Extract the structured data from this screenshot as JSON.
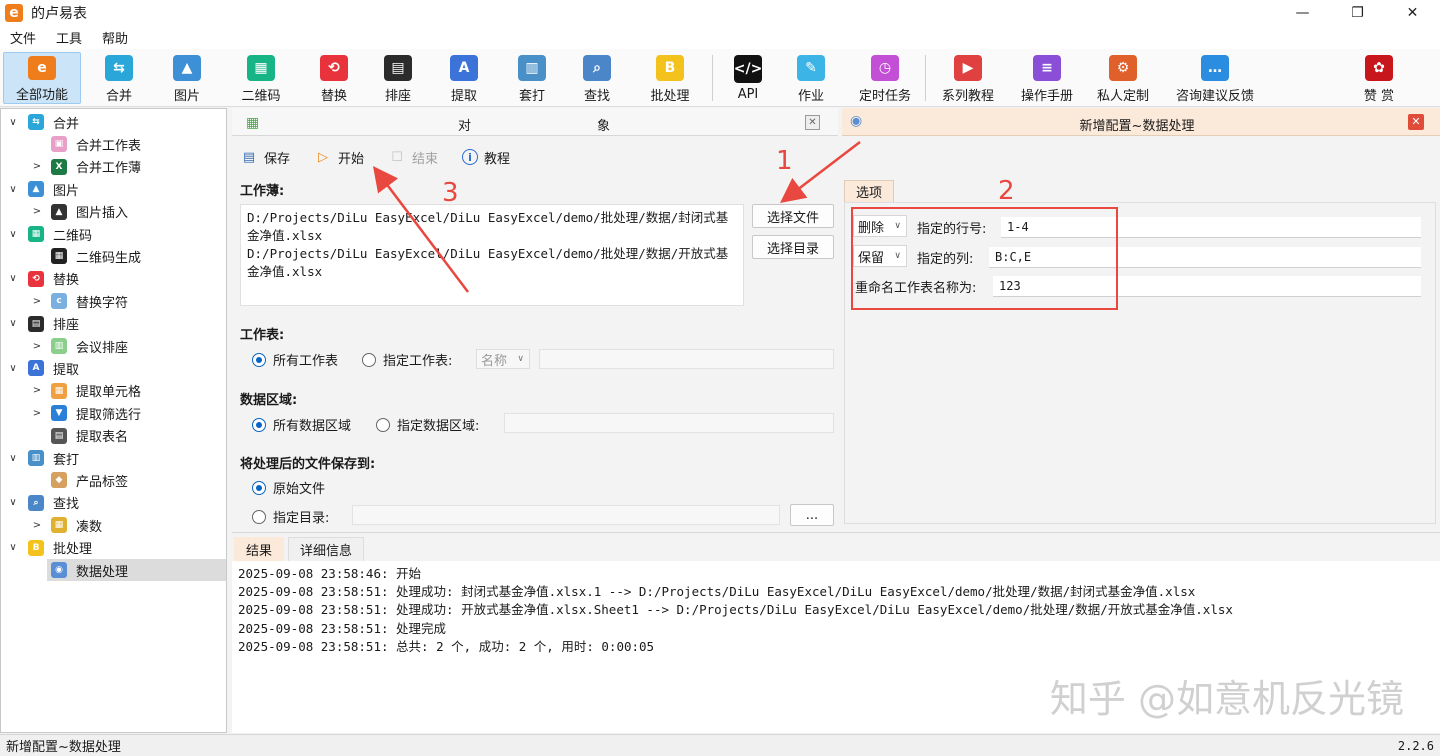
{
  "window": {
    "logo_glyph": "e",
    "title": "的卢易表",
    "min_glyph": "—",
    "max_glyph": "❐",
    "close_glyph": "✕"
  },
  "menu": [
    "文件",
    "工具",
    "帮助"
  ],
  "toolbar": {
    "items": [
      {
        "label": "全部功能",
        "icon": "all-features-icon",
        "color": "#f07d1c",
        "glyph": "e"
      },
      {
        "label": "合并",
        "icon": "merge-icon",
        "color": "#2aa7d8",
        "glyph": "⇆"
      },
      {
        "label": "图片",
        "icon": "picture-icon",
        "color": "#3d8fd6",
        "glyph": "▲"
      },
      {
        "label": "二维码",
        "icon": "qrcode-icon",
        "color": "#17b486",
        "glyph": "▦"
      },
      {
        "label": "替换",
        "icon": "replace-icon",
        "color": "#e8323c",
        "glyph": "⟲"
      },
      {
        "label": "排座",
        "icon": "seating-icon",
        "color": "#2b2b2b",
        "glyph": "▤"
      },
      {
        "label": "提取",
        "icon": "extract-icon",
        "color": "#3b73d9",
        "glyph": "A"
      },
      {
        "label": "套打",
        "icon": "print-template-icon",
        "color": "#4a90c8",
        "glyph": "▥"
      },
      {
        "label": "查找",
        "icon": "search-icon",
        "color": "#4a86c8",
        "glyph": "⌕"
      },
      {
        "label": "批处理",
        "icon": "batch-icon",
        "color": "#f3c21c",
        "glyph": "B"
      },
      {
        "label": "API",
        "icon": "api-icon",
        "color": "#111111",
        "glyph": "</>"
      },
      {
        "label": "作业",
        "icon": "homework-icon",
        "color": "#3cb4e6",
        "glyph": "✎"
      },
      {
        "label": "定时任务",
        "icon": "timer-task-icon",
        "color": "#c34fd6",
        "glyph": "◷"
      },
      {
        "label": "系列教程",
        "icon": "tutorial-series-icon",
        "color": "#e04040",
        "glyph": "▶"
      },
      {
        "label": "操作手册",
        "icon": "manual-icon",
        "color": "#8a4fd6",
        "glyph": "≡"
      },
      {
        "label": "私人定制",
        "icon": "custom-icon",
        "color": "#e0602c",
        "glyph": "⚙"
      },
      {
        "label": "咨询建议反馈",
        "icon": "feedback-icon",
        "color": "#2a8de0",
        "glyph": "…"
      },
      {
        "label": "赞 赏",
        "icon": "reward-rose-icon",
        "color": "#c8161d",
        "glyph": "✿"
      }
    ]
  },
  "sidebar": {
    "items": [
      {
        "label": "合并",
        "level": 0,
        "arrow": "∨",
        "icon": "merge-icon",
        "color": "#2aa7d8",
        "glyph": "⇆"
      },
      {
        "label": "合并工作表",
        "level": 1,
        "arrow": "",
        "icon": "merge-sheets-icon",
        "color": "#e8a0c8",
        "glyph": "▣"
      },
      {
        "label": "合并工作薄",
        "level": 1,
        "arrow": ">",
        "icon": "excel-icon",
        "color": "#1d7a44",
        "glyph": "X"
      },
      {
        "label": "图片",
        "level": 0,
        "arrow": "∨",
        "icon": "picture-icon",
        "color": "#3d8fd6",
        "glyph": "▲"
      },
      {
        "label": "图片插入",
        "level": 1,
        "arrow": ">",
        "icon": "image-insert-icon",
        "color": "#333333",
        "glyph": "▲"
      },
      {
        "label": "二维码",
        "level": 0,
        "arrow": "∨",
        "icon": "qrcode-icon",
        "color": "#17b486",
        "glyph": "▦"
      },
      {
        "label": "二维码生成",
        "level": 1,
        "arrow": "",
        "icon": "qrcode-generate-icon",
        "color": "#222222",
        "glyph": "▦"
      },
      {
        "label": "替换",
        "level": 0,
        "arrow": "∨",
        "icon": "replace-icon",
        "color": "#e8323c",
        "glyph": "⟲"
      },
      {
        "label": "替换字符",
        "level": 1,
        "arrow": ">",
        "icon": "replace-chars-icon",
        "color": "#7ab0e0",
        "glyph": "c"
      },
      {
        "label": "排座",
        "level": 0,
        "arrow": "∨",
        "icon": "seating-icon",
        "color": "#2b2b2b",
        "glyph": "▤"
      },
      {
        "label": "会议排座",
        "level": 1,
        "arrow": ">",
        "icon": "meeting-seating-icon",
        "color": "#8ccf8c",
        "glyph": "▥"
      },
      {
        "label": "提取",
        "level": 0,
        "arrow": "∨",
        "icon": "extract-icon",
        "color": "#3b73d9",
        "glyph": "A"
      },
      {
        "label": "提取单元格",
        "level": 1,
        "arrow": ">",
        "icon": "extract-cells-icon",
        "color": "#f0a040",
        "glyph": "▦"
      },
      {
        "label": "提取筛选行",
        "level": 1,
        "arrow": ">",
        "icon": "filter-icon",
        "color": "#2a7fd6",
        "glyph": "▼"
      },
      {
        "label": "提取表名",
        "level": 1,
        "arrow": "",
        "icon": "extract-sheet-names-icon",
        "color": "#555555",
        "glyph": "▤"
      },
      {
        "label": "套打",
        "level": 0,
        "arrow": "∨",
        "icon": "print-template-icon",
        "color": "#4a90c8",
        "glyph": "▥"
      },
      {
        "label": "产品标签",
        "level": 1,
        "arrow": "",
        "icon": "product-label-icon",
        "color": "#d6a060",
        "glyph": "◆"
      },
      {
        "label": "查找",
        "level": 0,
        "arrow": "∨",
        "icon": "search-icon",
        "color": "#4a86c8",
        "glyph": "⌕"
      },
      {
        "label": "凑数",
        "level": 1,
        "arrow": ">",
        "icon": "calculator-icon",
        "color": "#e0b030",
        "glyph": "▦"
      },
      {
        "label": "批处理",
        "level": 0,
        "arrow": "∨",
        "icon": "batch-icon",
        "color": "#f3c21c",
        "glyph": "B"
      },
      {
        "label": "数据处理",
        "level": 1,
        "arrow": "",
        "icon": "data-process-icon",
        "color": "#5a8fd6",
        "glyph": "◉",
        "selected": true
      }
    ]
  },
  "object_panel": {
    "header_icon": "grid-icon",
    "title_left": "对",
    "title_right": "象",
    "close_glyph": "✕",
    "actions": {
      "save": "保存",
      "start": "开始",
      "end": "结束",
      "tutorial": "教程"
    },
    "workbook_label": "工作薄:",
    "workbook_lines": [
      "D:/Projects/DiLu EasyExcel/DiLu EasyExcel/demo/批处理/数据/封闭式基",
      "金净值.xlsx",
      "D:/Projects/DiLu EasyExcel/DiLu EasyExcel/demo/批处理/数据/开放式基",
      "金净值.xlsx"
    ],
    "select_file": "选择文件",
    "select_dir": "选择目录",
    "sheet_label": "工作表:",
    "sheet_all": "所有工作表",
    "sheet_specified": "指定工作表:",
    "sheet_name_placeholder": "名称",
    "range_label": "数据区域:",
    "range_all": "所有数据区域",
    "range_specified": "指定数据区域:",
    "save_to_label": "将处理后的文件保存到:",
    "save_original": "原始文件",
    "save_dir": "指定目录:",
    "browse": "..."
  },
  "config_panel": {
    "title": "新增配置~数据处理",
    "close_glyph": "✕",
    "tab": "选项",
    "row1": {
      "combo": "删除",
      "label": "指定的行号:",
      "value": "1-4"
    },
    "row2": {
      "combo": "保留",
      "label": "指定的列:",
      "value": "B:C,E"
    },
    "row3": {
      "label": "重命名工作表名称为:",
      "value": "123"
    }
  },
  "result_panel": {
    "tabs": [
      "结果",
      "详细信息"
    ],
    "log": [
      "2025-09-08 23:58:46: 开始",
      "2025-09-08 23:58:51: 处理成功: 封闭式基金净值.xlsx.1 --> D:/Projects/DiLu EasyExcel/DiLu EasyExcel/demo/批处理/数据/封闭式基金净值.xlsx",
      "2025-09-08 23:58:51: 处理成功: 开放式基金净值.xlsx.Sheet1 --> D:/Projects/DiLu EasyExcel/DiLu EasyExcel/demo/批处理/数据/开放式基金净值.xlsx",
      "2025-09-08 23:58:51: 处理完成",
      "2025-09-08 23:58:51: 总共: 2 个, 成功: 2 个, 用时: 0:00:05"
    ],
    "watermark": "知乎 @如意机反光镜"
  },
  "status": {
    "text": "新增配置~数据处理",
    "version": "2.2.6"
  },
  "annotations": [
    "1",
    "2",
    "3"
  ],
  "colors": {
    "accent": "#0a64c4",
    "annotation_red": "#e8483f",
    "config_header": "#fbe9d9"
  }
}
